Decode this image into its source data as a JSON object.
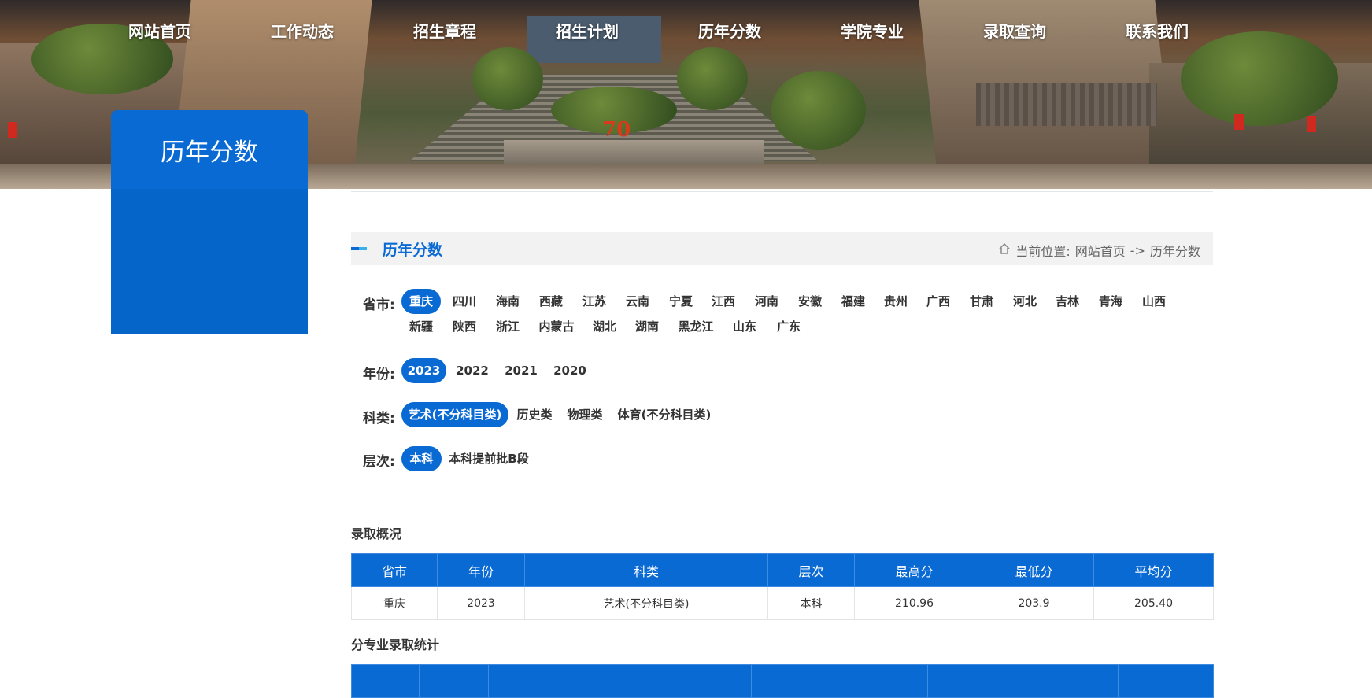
{
  "nav": {
    "items": [
      "网站首页",
      "工作动态",
      "招生章程",
      "招生计划",
      "历年分数",
      "学院专业",
      "录取查询",
      "联系我们"
    ]
  },
  "side": {
    "title": "历年分数"
  },
  "titlebar": {
    "title": "历年分数",
    "crumb_prefix": "当前位置:",
    "crumb_home": "网站首页",
    "crumb_sep": "->",
    "crumb_current": "历年分数"
  },
  "filters": {
    "province": {
      "label": "省市:",
      "options": [
        "重庆",
        "四川",
        "海南",
        "西藏",
        "江苏",
        "云南",
        "宁夏",
        "江西",
        "河南",
        "安徽",
        "福建",
        "贵州",
        "广西",
        "甘肃",
        "河北",
        "吉林",
        "青海",
        "山西",
        "新疆",
        "陕西",
        "浙江",
        "内蒙古",
        "湖北",
        "湖南",
        "黑龙江",
        "山东",
        "广东"
      ],
      "selected": "重庆"
    },
    "year": {
      "label": "年份:",
      "options": [
        "2023",
        "2022",
        "2021",
        "2020"
      ],
      "selected": "2023"
    },
    "category": {
      "label": "科类:",
      "options": [
        "艺术(不分科目类)",
        "历史类",
        "物理类",
        "体育(不分科目类)"
      ],
      "selected": "艺术(不分科目类)"
    },
    "level": {
      "label": "层次:",
      "options": [
        "本科",
        "本科提前批B段"
      ],
      "selected": "本科"
    }
  },
  "summary": {
    "title": "录取概况",
    "columns": [
      "省市",
      "年份",
      "科类",
      "层次",
      "最高分",
      "最低分",
      "平均分"
    ],
    "rows": [
      [
        "重庆",
        "2023",
        "艺术(不分科目类)",
        "本科",
        "210.96",
        "203.9",
        "205.40"
      ]
    ]
  },
  "by_major": {
    "title": "分专业录取统计"
  },
  "colors": {
    "primary": "#0a6ad3",
    "sidebar": "#0665c9",
    "titlebar_bg": "#f2f2f2"
  }
}
